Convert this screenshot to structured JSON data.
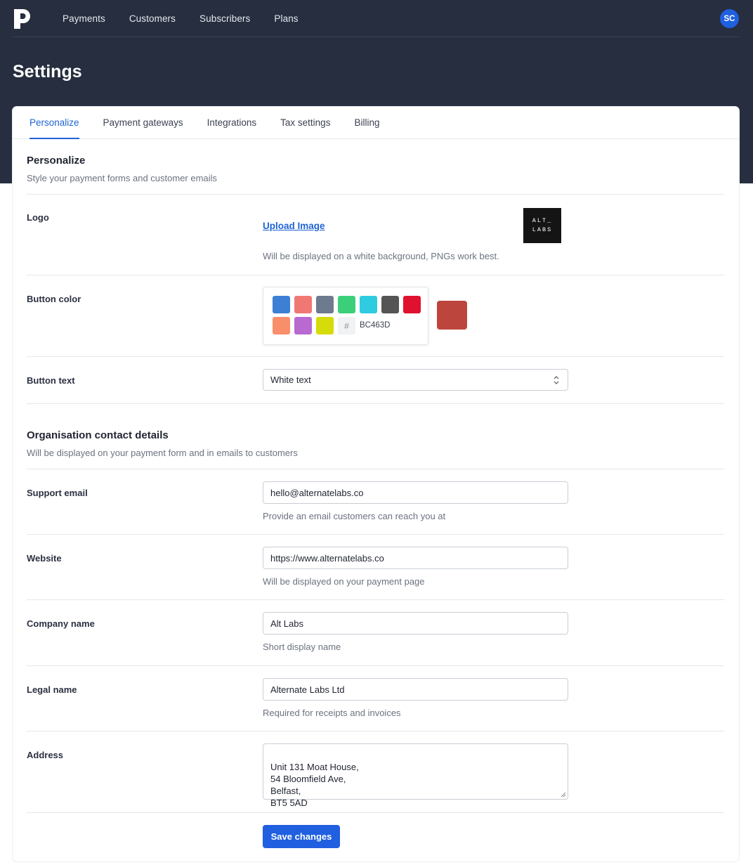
{
  "nav": {
    "brand_icon": "p-logo-icon",
    "links": [
      "Payments",
      "Customers",
      "Subscribers",
      "Plans"
    ],
    "avatar_initials": "SC"
  },
  "page": {
    "title": "Settings"
  },
  "tabs": [
    {
      "label": "Personalize",
      "active": true
    },
    {
      "label": "Payment gateways",
      "active": false
    },
    {
      "label": "Integrations",
      "active": false
    },
    {
      "label": "Tax settings",
      "active": false
    },
    {
      "label": "Billing",
      "active": false
    }
  ],
  "personalize": {
    "title": "Personalize",
    "subtitle": "Style your payment forms and customer emails",
    "logo": {
      "label": "Logo",
      "upload_label": "Upload Image",
      "help": "Will be displayed on a white background, PNGs work best.",
      "logo_lines": [
        "ALT_",
        "LABS"
      ]
    },
    "button_color": {
      "label": "Button color",
      "swatches": [
        "#3d7fd4",
        "#f07874",
        "#6e7a8d",
        "#3ccf7a",
        "#2fcbe0",
        "#555555",
        "#e0102f",
        "#f98f6a",
        "#b86ad1",
        "#d6dc0a"
      ],
      "hash": "#",
      "hex": "BC463D",
      "preview_color": "#bc463d"
    },
    "button_text": {
      "label": "Button text",
      "value": "White text"
    }
  },
  "contact": {
    "title": "Organisation contact details",
    "subtitle": "Will be displayed on your payment form and in emails to customers",
    "support_email": {
      "label": "Support email",
      "value": "hello@alternatelabs.co",
      "help": "Provide an email customers can reach you at"
    },
    "website": {
      "label": "Website",
      "value": "https://www.alternatelabs.co",
      "help": "Will be displayed on your payment page"
    },
    "company_name": {
      "label": "Company name",
      "value": "Alt Labs",
      "help": "Short display name"
    },
    "legal_name": {
      "label": "Legal name",
      "value": "Alternate Labs Ltd",
      "help": "Required for receipts and invoices"
    },
    "address": {
      "label": "Address",
      "value": "Unit 131 Moat House,\n54 Bloomfield Ave,\nBelfast,\nBT5 5AD"
    }
  },
  "actions": {
    "save_label": "Save changes"
  }
}
